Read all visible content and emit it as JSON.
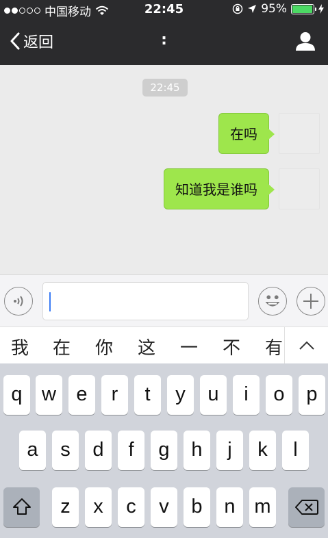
{
  "status_bar": {
    "carrier": "中国移动",
    "time": "22:45",
    "battery_percent": "95%",
    "signal_bars": 2
  },
  "nav": {
    "back_label": "返回",
    "title": ":"
  },
  "chat": {
    "timestamp": "22:45",
    "messages": [
      {
        "text": "在吗",
        "sender": "self"
      },
      {
        "text": "知道我是谁吗",
        "sender": "self"
      }
    ]
  },
  "candidates": [
    "我",
    "在",
    "你",
    "这",
    "一",
    "不",
    "有"
  ],
  "keyboard": {
    "row1": [
      "q",
      "w",
      "e",
      "r",
      "t",
      "y",
      "u",
      "i",
      "o",
      "p"
    ],
    "row2": [
      "a",
      "s",
      "d",
      "f",
      "g",
      "h",
      "j",
      "k",
      "l"
    ],
    "row3": [
      "z",
      "x",
      "c",
      "v",
      "b",
      "n",
      "m"
    ]
  },
  "colors": {
    "nav_bg": "#2b2b2d",
    "bubble": "#9ee64c",
    "battery": "#4cd964",
    "caret": "#3a7bf5"
  },
  "icons": [
    "wifi-icon",
    "lock-rotation-icon",
    "location-arrow-icon",
    "battery-icon",
    "charging-icon",
    "back-chevron-icon",
    "profile-icon",
    "voice-icon",
    "emoji-icon",
    "plus-icon",
    "chevron-up-icon",
    "shift-icon",
    "backspace-icon"
  ]
}
